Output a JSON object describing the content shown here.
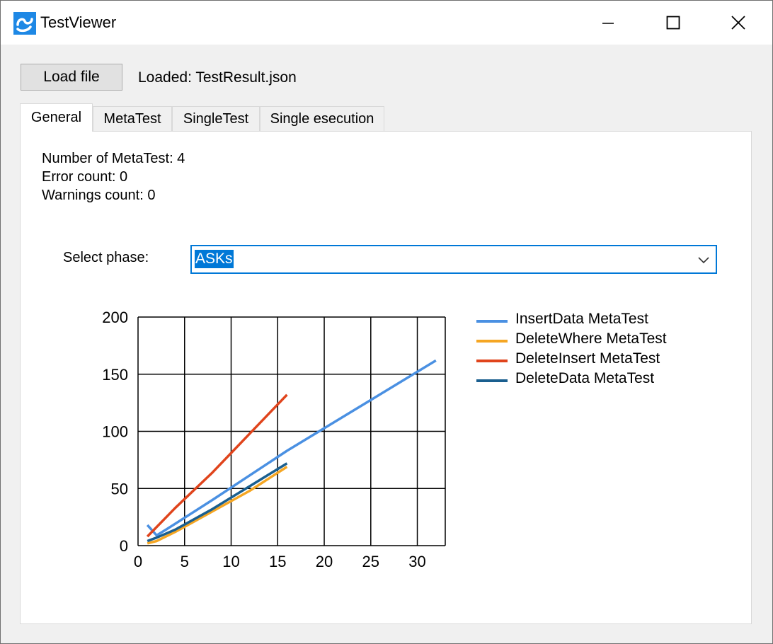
{
  "window": {
    "title": "TestViewer",
    "minimize": "—",
    "maximize": "☐",
    "close": "✕"
  },
  "toolbar": {
    "load_label": "Load file",
    "loaded_text": "Loaded: TestResult.json"
  },
  "tabs": [
    {
      "label": "General",
      "active": true
    },
    {
      "label": "MetaTest",
      "active": false
    },
    {
      "label": "SingleTest",
      "active": false
    },
    {
      "label": "Single esecution",
      "active": false
    }
  ],
  "general": {
    "metatest_count": "Number of MetaTest: 4",
    "error_count": "Error count: 0",
    "warnings_count": "Warnings count: 0",
    "phase_label": "Select phase:",
    "phase_value": "ASKs"
  },
  "colors": {
    "accent": "#0078d7"
  },
  "chart_data": {
    "type": "line",
    "xlim": [
      0,
      33
    ],
    "ylim": [
      0,
      200
    ],
    "x_ticks": [
      0,
      5,
      10,
      15,
      20,
      25,
      30
    ],
    "y_ticks": [
      0,
      50,
      100,
      150,
      200
    ],
    "grid": true,
    "legend_position": "top-right",
    "series": [
      {
        "name": "InsertData MetaTest",
        "color": "#4a90e2",
        "points": [
          [
            1,
            18
          ],
          [
            2,
            9
          ],
          [
            3,
            14
          ],
          [
            8,
            40
          ],
          [
            16,
            83
          ],
          [
            32,
            162
          ]
        ]
      },
      {
        "name": "DeleteWhere MetaTest",
        "color": "#f5a623",
        "points": [
          [
            1,
            2
          ],
          [
            2,
            4
          ],
          [
            4,
            12
          ],
          [
            8,
            30
          ],
          [
            12,
            48
          ],
          [
            16,
            69
          ]
        ]
      },
      {
        "name": "DeleteInsert MetaTest",
        "color": "#e0441c",
        "points": [
          [
            1,
            8
          ],
          [
            4,
            33
          ],
          [
            8,
            64
          ],
          [
            12,
            98
          ],
          [
            16,
            132
          ]
        ]
      },
      {
        "name": "DeleteData MetaTest",
        "color": "#1a5f8f",
        "points": [
          [
            1,
            4
          ],
          [
            2,
            7
          ],
          [
            4,
            14
          ],
          [
            8,
            32
          ],
          [
            12,
            52
          ],
          [
            16,
            72
          ]
        ]
      }
    ]
  }
}
